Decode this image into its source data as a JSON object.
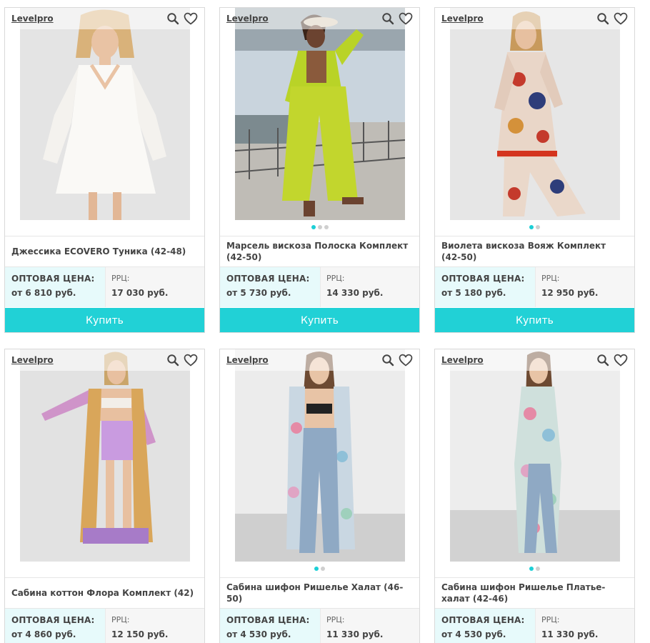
{
  "brand": "Levelpro",
  "labels": {
    "wholesale": "ОПТОВАЯ ЦЕНА:",
    "rrc": "РРЦ:",
    "buy": "Купить"
  },
  "colors": {
    "accent": "#21d1d6",
    "wholesale_bg": "#e7fafb"
  },
  "icons": [
    "search-icon",
    "heart-icon"
  ],
  "products": [
    {
      "title": "Джессика ECOVERO Туника (42-48)",
      "wholesale": "от 6 810 руб.",
      "rrc": "17 030 руб.",
      "slides": 1,
      "active_slide": 1
    },
    {
      "title": "Марсель вискоза Полоска Комплект (42-50)",
      "wholesale": "от 5 730 руб.",
      "rrc": "14 330 руб.",
      "slides": 3,
      "active_slide": 1
    },
    {
      "title": "Виолета вискоза Вояж Комплект (42-50)",
      "wholesale": "от 5 180 руб.",
      "rrc": "12 950 руб.",
      "slides": 2,
      "active_slide": 1
    },
    {
      "title": "Сабина коттон Флора Комплект (42)",
      "wholesale": "от 4 860 руб.",
      "rrc": "12 150 руб.",
      "slides": 1,
      "active_slide": 1
    },
    {
      "title": "Сабина шифон Ришелье Халат (46-50)",
      "wholesale": "от 4 530 руб.",
      "rrc": "11 330 руб.",
      "slides": 2,
      "active_slide": 1
    },
    {
      "title": "Сабина шифон Ришелье Платье-халат (42-46)",
      "wholesale": "от 4 530 руб.",
      "rrc": "11 330 руб.",
      "slides": 2,
      "active_slide": 1
    }
  ]
}
